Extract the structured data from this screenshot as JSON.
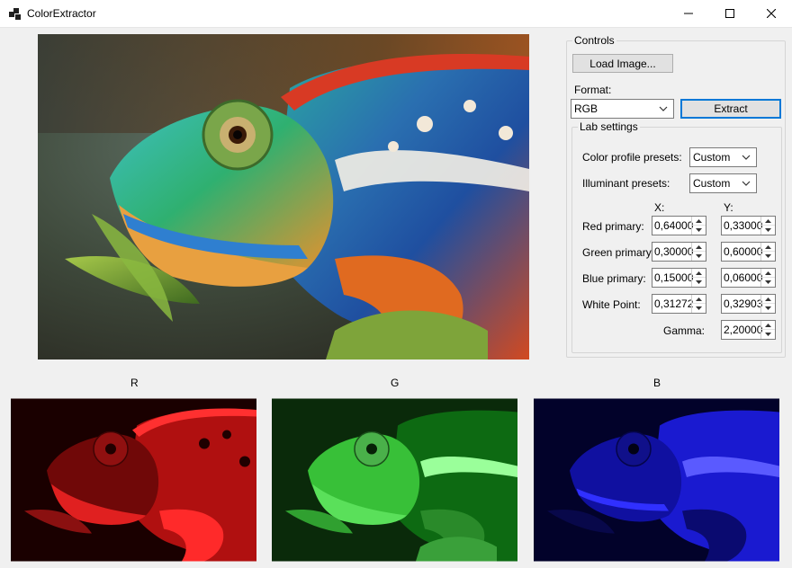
{
  "window": {
    "title": "ColorExtractor",
    "icons": {
      "app": "app-icon",
      "minimize": "minimize-icon",
      "maximize": "maximize-icon",
      "close": "close-icon"
    }
  },
  "preview": {
    "image": "chameleon-photo"
  },
  "controls": {
    "group_title": "Controls",
    "load_button": "Load Image...",
    "format_label": "Format:",
    "format_value": "RGB",
    "extract_button": "Extract",
    "lab": {
      "group_title": "Lab settings",
      "color_profile_label": "Color profile presets:",
      "color_profile_value": "Custom",
      "illuminant_label": "Illuminant presets:",
      "illuminant_value": "Custom",
      "x_header": "X:",
      "y_header": "Y:",
      "rows": [
        {
          "label": "Red primary:",
          "x": "0,64000",
          "y": "0,33000"
        },
        {
          "label": "Green primary:",
          "x": "0,30000",
          "y": "0,60000"
        },
        {
          "label": "Blue primary:",
          "x": "0,15000",
          "y": "0,06000"
        },
        {
          "label": "White Point:",
          "x": "0,31272",
          "y": "0,32903"
        }
      ],
      "gamma_label": "Gamma:",
      "gamma_value": "2,20000"
    }
  },
  "channels": [
    {
      "label": "R",
      "color": "#e01010"
    },
    {
      "label": "G",
      "color": "#18c018"
    },
    {
      "label": "B",
      "color": "#1a1aff"
    }
  ]
}
